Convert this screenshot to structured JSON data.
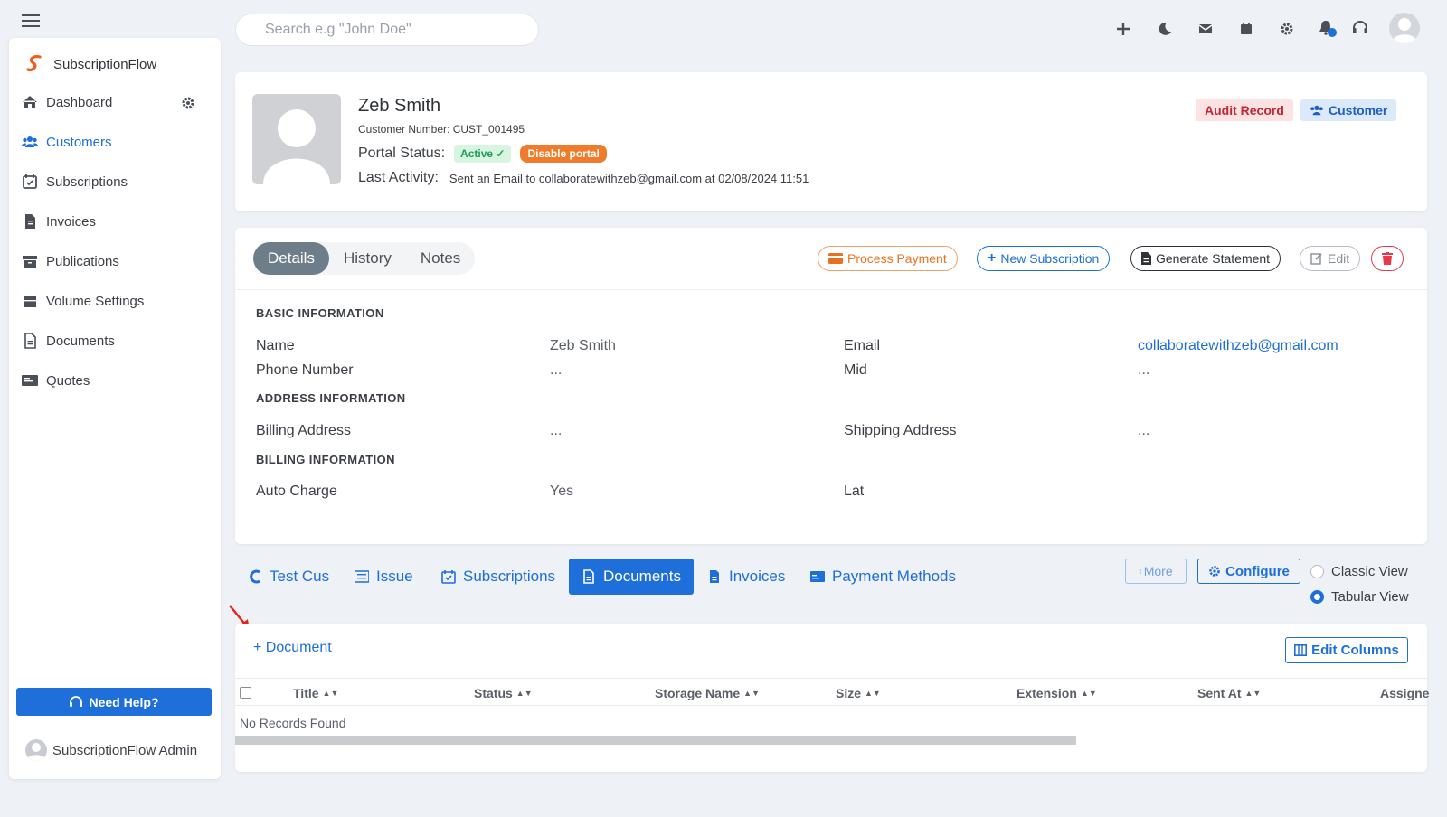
{
  "app": {
    "name": "SubscriptionFlow",
    "brand_color": "#1e6fd9"
  },
  "search": {
    "placeholder": "Search e.g \"John Doe\""
  },
  "sidebar": {
    "items": [
      {
        "label": "Dashboard",
        "icon": "home-icon"
      },
      {
        "label": "Customers",
        "icon": "users-icon",
        "active": true
      },
      {
        "label": "Subscriptions",
        "icon": "calendar-check-icon"
      },
      {
        "label": "Invoices",
        "icon": "invoice-icon"
      },
      {
        "label": "Publications",
        "icon": "archive-icon"
      },
      {
        "label": "Volume Settings",
        "icon": "box-icon"
      },
      {
        "label": "Documents",
        "icon": "document-icon"
      },
      {
        "label": "Quotes",
        "icon": "quotes-icon"
      }
    ],
    "help_label": "Need Help?",
    "admin_name": "SubscriptionFlow Admin"
  },
  "topbar": {
    "icons": [
      "plus-icon",
      "moon-icon",
      "mail-icon",
      "calendar-icon",
      "gear-icon",
      "bell-icon",
      "headset-icon",
      "user-avatar"
    ]
  },
  "profile": {
    "name": "Zeb Smith",
    "customer_number": "Customer Number: CUST_001495",
    "portal_status_label": "Portal Status:",
    "portal_status_value": "Active",
    "disable_portal_label": "Disable portal",
    "last_activity_label": "Last Activity:",
    "last_activity_value": "Sent an Email to collaboratewithzeb@gmail.com at 02/08/2024 11:51",
    "audit_label": "Audit Record",
    "customer_label": "Customer"
  },
  "details": {
    "tabs": [
      "Details",
      "History",
      "Notes"
    ],
    "actions": {
      "process_payment": "Process Payment",
      "new_subscription": "New Subscription",
      "generate_statement": "Generate Statement",
      "edit": "Edit"
    },
    "basic_info_heading": "BASIC INFORMATION",
    "address_info_heading": "ADDRESS INFORMATION",
    "billing_info_heading": "BILLING INFORMATION",
    "fields": {
      "name_label": "Name",
      "name_value": "Zeb Smith",
      "email_label": "Email",
      "email_value": "collaboratewithzeb@gmail.com",
      "phone_label": "Phone Number",
      "phone_value": "...",
      "mid_label": "Mid",
      "mid_value": "...",
      "billing_address_label": "Billing Address",
      "billing_address_value": "...",
      "shipping_address_label": "Shipping Address",
      "shipping_address_value": "...",
      "auto_charge_label": "Auto Charge",
      "auto_charge_value": "Yes",
      "lat_label": "Lat"
    }
  },
  "subtabs": {
    "items": [
      "Test Cus",
      "Issue",
      "Subscriptions",
      "Documents",
      "Invoices",
      "Payment Methods"
    ],
    "active": "Documents",
    "more_label": "More",
    "configure_label": "Configure",
    "classic_view": "Classic View",
    "tabular_view": "Tabular View"
  },
  "documents": {
    "add_label": "+ Document",
    "edit_columns_label": "Edit Columns",
    "columns": [
      "Title",
      "Status",
      "Storage Name",
      "Size",
      "Extension",
      "Sent At",
      "Assigne"
    ],
    "empty_message": "No Records Found"
  }
}
